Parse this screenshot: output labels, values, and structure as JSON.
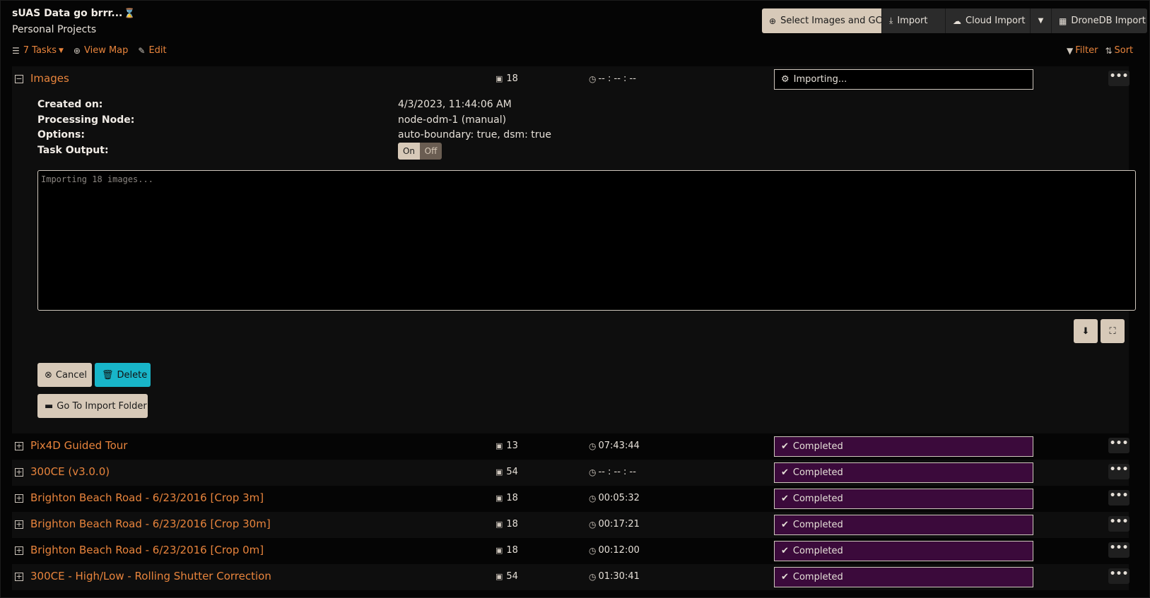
{
  "project": {
    "title": "sUAS Data go brrr...",
    "title_emoji": "⌛",
    "description": "Personal Projects"
  },
  "toolbar": {
    "tasks_label": "7 Tasks",
    "view_map_label": "View Map",
    "edit_label": "Edit",
    "filter_label": "Filter",
    "sort_label": "Sort"
  },
  "buttons": {
    "select_images": "Select Images and GCP",
    "import": "Import",
    "cloud_import": "Cloud Import",
    "dronedb_import": "DroneDB Import"
  },
  "expanded_task": {
    "name": "Images",
    "image_count": "18",
    "time": "-- : -- : --",
    "status": "Importing...",
    "details": {
      "created_on_label": "Created on:",
      "created_on_value": "4/3/2023, 11:44:06 AM",
      "processing_node_label": "Processing Node:",
      "processing_node_value": "node-odm-1 (manual)",
      "options_label": "Options:",
      "options_value": "auto-boundary: true, dsm: true",
      "task_output_label": "Task Output:",
      "toggle_on": "On",
      "toggle_off": "Off"
    },
    "console_text": "Importing 18 images...",
    "cancel_label": "Cancel",
    "delete_label": "Delete",
    "go_to_folder_label": "Go To Import Folder"
  },
  "tasks": [
    {
      "name": "Pix4D Guided Tour",
      "image_count": "13",
      "time": "07:43:44",
      "status": "Completed"
    },
    {
      "name": "300CE (v3.0.0)",
      "image_count": "54",
      "time": "-- : -- : --",
      "status": "Completed"
    },
    {
      "name": "Brighton Beach Road - 6/23/2016 [Crop 3m]",
      "image_count": "18",
      "time": "00:05:32",
      "status": "Completed"
    },
    {
      "name": "Brighton Beach Road - 6/23/2016 [Crop 30m]",
      "image_count": "18",
      "time": "00:17:21",
      "status": "Completed"
    },
    {
      "name": "Brighton Beach Road - 6/23/2016 [Crop 0m]",
      "image_count": "18",
      "time": "00:12:00",
      "status": "Completed"
    },
    {
      "name": "300CE - High/Low - Rolling Shutter Correction",
      "image_count": "54",
      "time": "01:30:41",
      "status": "Completed"
    }
  ],
  "colors": {
    "accent": "#e8843c",
    "completed_bg": "#3b0a3b",
    "delete_bg": "#18b5c9",
    "primary_button_bg": "#d7c9b8"
  }
}
